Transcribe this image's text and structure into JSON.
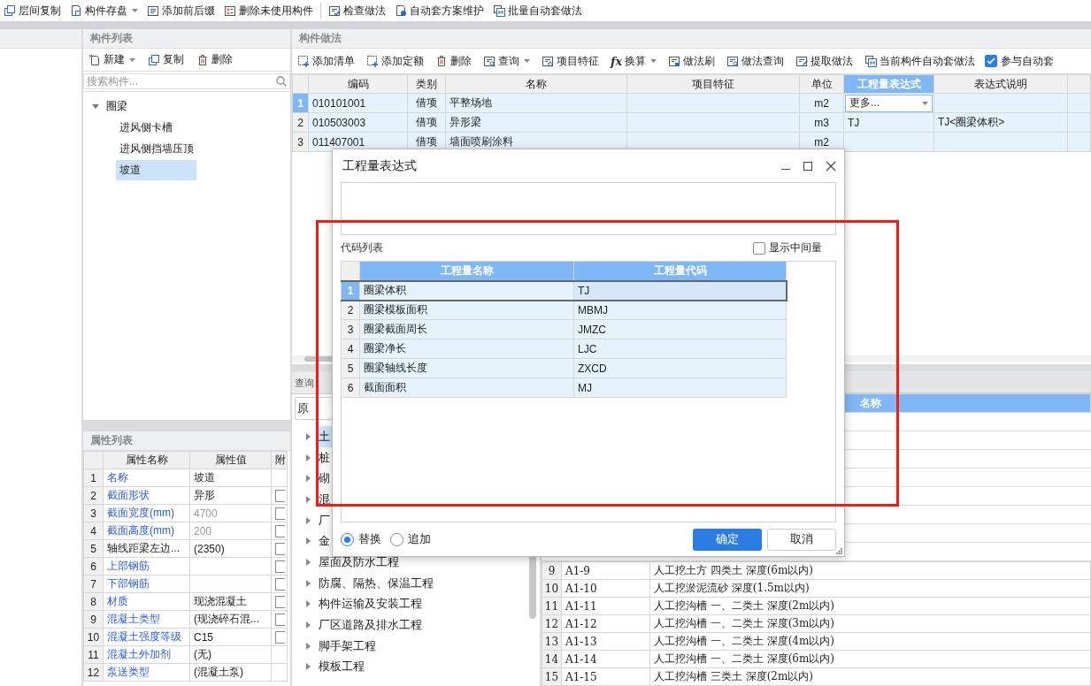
{
  "toolbar": [
    {
      "kind": "button",
      "label": "层间复制",
      "dropdown": false
    },
    {
      "kind": "button",
      "label": "构件存盘",
      "dropdown": true
    },
    {
      "kind": "button",
      "label": "添加前后缀",
      "dropdown": false
    },
    {
      "kind": "button",
      "label": "删除未使用构件",
      "dropdown": false
    },
    {
      "kind": "separator"
    },
    {
      "kind": "button",
      "label": "检查做法",
      "dropdown": false
    },
    {
      "kind": "button",
      "label": "自动套方案维护",
      "dropdown": false
    },
    {
      "kind": "button",
      "label": "批量自动套做法",
      "dropdown": false
    }
  ],
  "component_list": {
    "title": "构件列表",
    "toolbar": [
      {
        "label": "新建",
        "dropdown": true
      },
      {
        "label": "复制",
        "dropdown": false
      },
      {
        "label": "删除",
        "dropdown": false
      }
    ],
    "search": {
      "placeholder": "搜索构件..."
    },
    "tree": [
      {
        "label": "圈梁",
        "expanded": true,
        "selected": false,
        "children": [
          {
            "label": "进风侧卡槽",
            "selected": false
          },
          {
            "label": "进风侧挡墙压顶",
            "selected": false
          },
          {
            "label": "坡道",
            "selected": true
          }
        ]
      }
    ]
  },
  "property_list": {
    "title": "属性列表",
    "columns": [
      "属性名称",
      "属性值",
      "附"
    ],
    "rows": [
      {
        "index": "1",
        "name": "名称",
        "value": "坡道",
        "linked": true,
        "greyed": false
      },
      {
        "index": "2",
        "name": "截面形状",
        "value": "异形",
        "linked": true,
        "greyed": false,
        "attached": false
      },
      {
        "index": "3",
        "name": "截面宽度(mm)",
        "value": "4700",
        "linked": true,
        "greyed": true,
        "attached": false
      },
      {
        "index": "4",
        "name": "截面高度(mm)",
        "value": "200",
        "linked": true,
        "greyed": true,
        "attached": false
      },
      {
        "index": "5",
        "name": "轴线距梁左边...",
        "value": "(2350)",
        "linked": false,
        "greyed": false,
        "attached": false
      },
      {
        "index": "6",
        "name": "上部钢筋",
        "linked": true,
        "attached": false
      },
      {
        "index": "7",
        "name": "下部钢筋",
        "linked": true,
        "attached": false
      },
      {
        "index": "8",
        "name": "材质",
        "value": "现浇混凝土",
        "linked": true,
        "greyed": false,
        "attached": false
      },
      {
        "index": "9",
        "name": "混凝土类型",
        "value": "(现浇碎石混...",
        "linked": true,
        "greyed": false,
        "attached": false
      },
      {
        "index": "10",
        "name": "混凝土强度等级",
        "value": "C15",
        "linked": true,
        "greyed": false,
        "attached": false
      },
      {
        "index": "11",
        "name": "混凝土外加剂",
        "value": "(无)",
        "linked": true,
        "greyed": false
      },
      {
        "index": "12",
        "name": "泵送类型",
        "value": "(混凝土泵)",
        "linked": true,
        "greyed": false
      }
    ]
  },
  "method_panel": {
    "title": "构件做法",
    "toolbar": [
      {
        "label": "添加清单",
        "dropdown": false
      },
      {
        "label": "添加定额",
        "dropdown": false
      },
      {
        "label": "删除",
        "dropdown": false
      },
      {
        "label": "查询",
        "dropdown": true
      },
      {
        "label": "项目特征",
        "dropdown": false
      },
      {
        "label": "换算",
        "dropdown": true,
        "icon_text": "fx"
      },
      {
        "label": "做法刷",
        "dropdown": false
      },
      {
        "label": "做法查询",
        "dropdown": false
      },
      {
        "label": "提取做法",
        "dropdown": false
      },
      {
        "label": "当前构件自动套做法",
        "dropdown": false
      }
    ],
    "auto_apply": {
      "label": "参与自动套",
      "checked": true
    },
    "columns": [
      {
        "label": "编码",
        "selected": false
      },
      {
        "label": "类别",
        "selected": false
      },
      {
        "label": "名称",
        "selected": false
      },
      {
        "label": "项目特征",
        "selected": false
      },
      {
        "label": "单位",
        "selected": false
      },
      {
        "label": "工程量表达式",
        "selected": true
      },
      {
        "label": "表达式说明",
        "selected": false
      }
    ],
    "rows": [
      {
        "index": "1",
        "code": "010101001",
        "type": "借项",
        "name": "平整场地",
        "unit": "m2",
        "expression": "更多...",
        "editing": true,
        "selected": true
      },
      {
        "index": "2",
        "code": "010503003",
        "type": "借项",
        "name": "异形梁",
        "unit": "m3",
        "expression": "TJ",
        "editing": false,
        "note": "TJ<圈梁体积>",
        "selected": false
      },
      {
        "index": "3",
        "code": "011407001",
        "type": "借项",
        "name": "墙面喷刷涂料",
        "unit": "m2",
        "selected": false
      }
    ]
  },
  "query_panel": {
    "tab": "查询",
    "dropdown": "原",
    "tree": [
      {
        "label": "土",
        "selected": true
      },
      {
        "label": "桩",
        "selected": false
      },
      {
        "label": "砌",
        "selected": false
      },
      {
        "label": "混",
        "selected": false
      },
      {
        "label": "厂",
        "selected": false
      },
      {
        "label": "金",
        "selected": false
      },
      {
        "label": "屋面及防水工程",
        "selected": false
      },
      {
        "label": "防腐、隔热、保温工程",
        "selected": false
      },
      {
        "label": "构件运输及安装工程",
        "selected": false
      },
      {
        "label": "厂区道路及排水工程",
        "selected": false
      },
      {
        "label": "脚手架工程",
        "selected": false
      },
      {
        "label": "模板工程",
        "selected": false
      }
    ]
  },
  "result_table": {
    "columns": [
      {
        "label": "名称",
        "selected": true
      }
    ],
    "rows": [
      {
        "index": "9",
        "code": "A1-9",
        "name": "人工挖土方 四类土 深度(6m以内)"
      },
      {
        "index": "10",
        "code": "A1-10",
        "name": "人工挖淤泥流砂 深度(1.5m以内)"
      },
      {
        "index": "11",
        "code": "A1-11",
        "name": "人工挖沟槽 一、二类土 深度(2m以内)"
      },
      {
        "index": "12",
        "code": "A1-12",
        "name": "人工挖沟槽 一、二类土 深度(3m以内)"
      },
      {
        "index": "13",
        "code": "A1-13",
        "name": "人工挖沟槽 一、二类土 深度(4m以内)"
      },
      {
        "index": "14",
        "code": "A1-14",
        "name": "人工挖沟槽 一、二类土 深度(6m以内)"
      },
      {
        "index": "15",
        "code": "A1-15",
        "name": "人工挖沟槽 三类土 深度(2m以内)"
      }
    ]
  },
  "dialog": {
    "title": "工程量表达式",
    "code_list_label": "代码列表",
    "show_intermediate": {
      "label": "显示中间量",
      "checked": false
    },
    "columns": [
      "工程量名称",
      "工程量代码"
    ],
    "rows": [
      {
        "index": "1",
        "name": "圈梁体积",
        "code": "TJ",
        "selected": true
      },
      {
        "index": "2",
        "name": "圈梁模板面积",
        "code": "MBMJ",
        "selected": false
      },
      {
        "index": "3",
        "name": "圈梁截面周长",
        "code": "JMZC",
        "selected": false
      },
      {
        "index": "4",
        "name": "圈梁净长",
        "code": "LJC",
        "selected": false
      },
      {
        "index": "5",
        "name": "圈梁轴线长度",
        "code": "ZXCD",
        "selected": false
      },
      {
        "index": "6",
        "name": "截面面积",
        "code": "MJ",
        "selected": false
      }
    ],
    "modes": [
      {
        "label": "替换",
        "selected": true
      },
      {
        "label": "追加",
        "selected": false
      }
    ],
    "buttons": [
      {
        "label": "确定",
        "kind": "primary"
      },
      {
        "label": "取消",
        "kind": "secondary"
      }
    ]
  },
  "annotation": {
    "kind": "rectangle"
  }
}
